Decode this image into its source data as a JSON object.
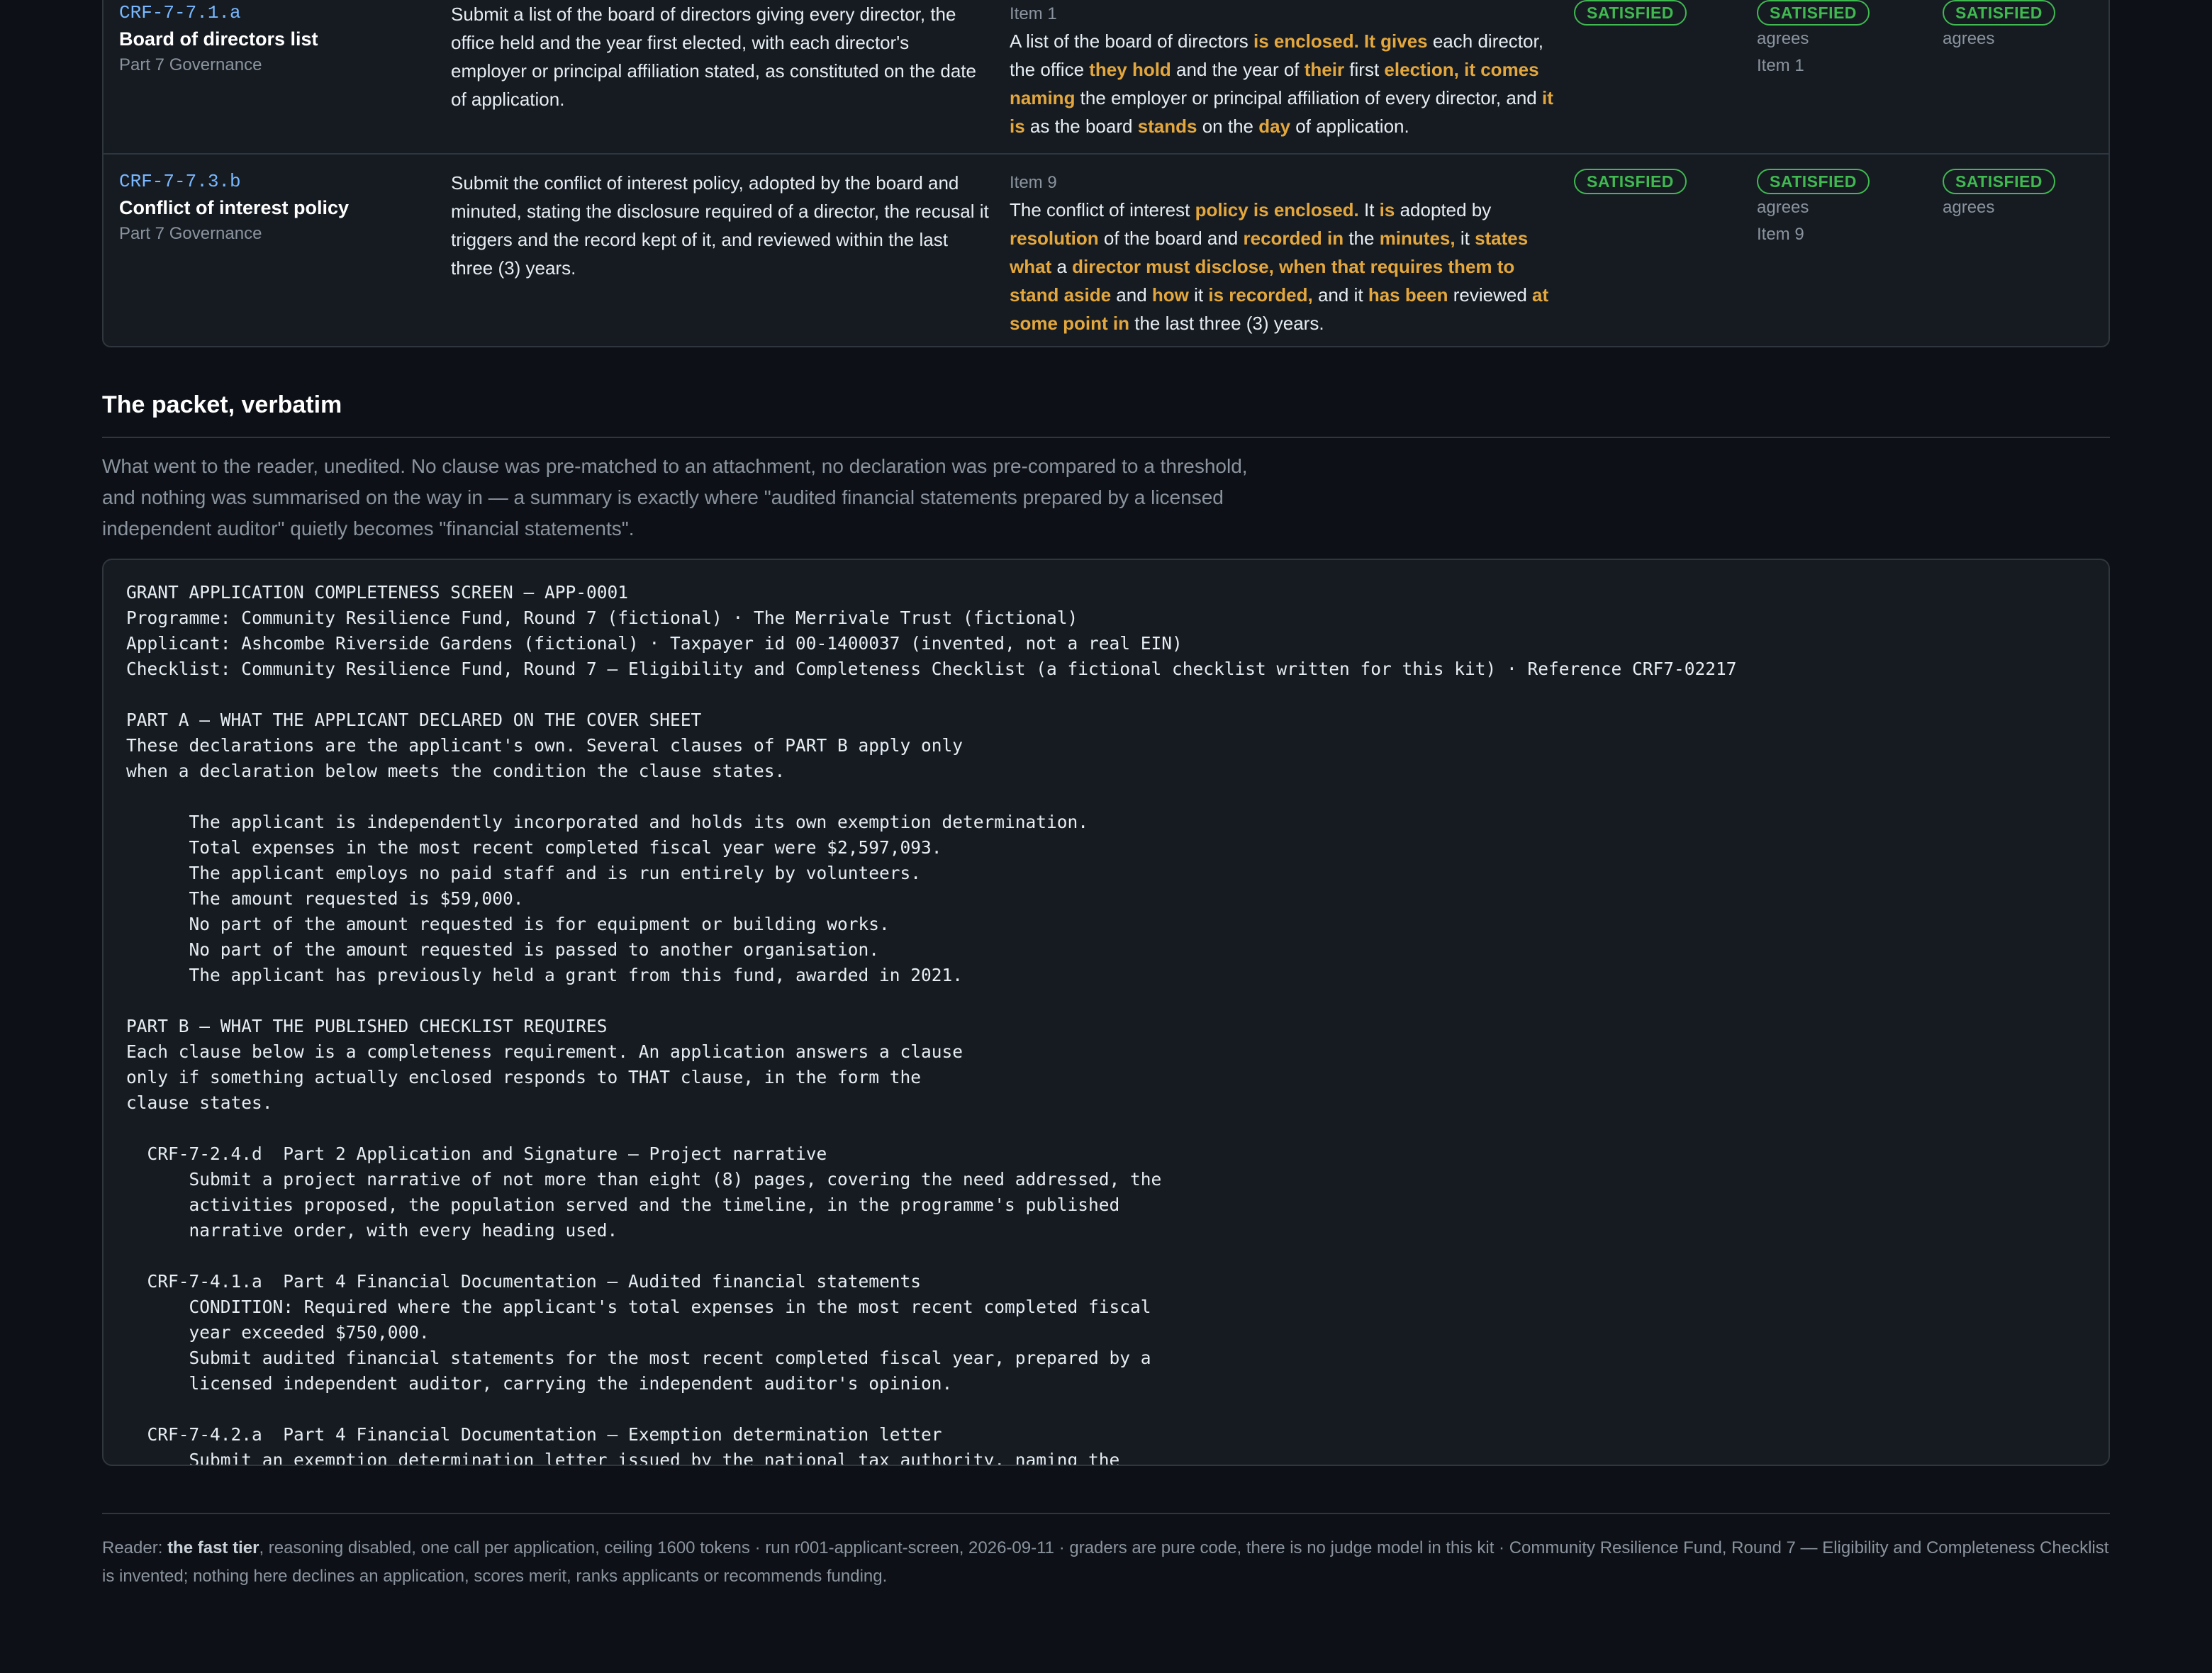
{
  "rows": [
    {
      "id": "CRF-7-7.1.a",
      "title": "Board of directors list",
      "part": "Part 7 Governance",
      "requirement": "Submit a list of the board of directors giving every director, the office held and the year first elected, with each director's employer or principal affiliation stated, as constituted on the date of application.",
      "evidence_item": "Item 1",
      "evidence_segments": [
        {
          "t": "A list of the board of directors ",
          "h": false
        },
        {
          "t": "is enclosed. It gives",
          "h": true
        },
        {
          "t": " each director, the office ",
          "h": false
        },
        {
          "t": "they hold",
          "h": true
        },
        {
          "t": " and the year of ",
          "h": false
        },
        {
          "t": "their",
          "h": true
        },
        {
          "t": " first ",
          "h": false
        },
        {
          "t": "election, it comes naming",
          "h": true
        },
        {
          "t": " the employer or principal affiliation of every director, and ",
          "h": false
        },
        {
          "t": "it is",
          "h": true
        },
        {
          "t": " as the board ",
          "h": false
        },
        {
          "t": "stands",
          "h": true
        },
        {
          "t": " on the ",
          "h": false
        },
        {
          "t": "day",
          "h": true
        },
        {
          "t": " of application.",
          "h": false
        }
      ],
      "status_1": "SATISFIED",
      "status_2": "SATISFIED",
      "status_2_note": "agrees",
      "status_2_item": "Item 1",
      "status_3": "SATISFIED",
      "status_3_note": "agrees"
    },
    {
      "id": "CRF-7-7.3.b",
      "title": "Conflict of interest policy",
      "part": "Part 7 Governance",
      "requirement": "Submit the conflict of interest policy, adopted by the board and minuted, stating the disclosure required of a director, the recusal it triggers and the record kept of it, and reviewed within the last three (3) years.",
      "evidence_item": "Item 9",
      "evidence_segments": [
        {
          "t": "The conflict of interest ",
          "h": false
        },
        {
          "t": "policy is enclosed.",
          "h": true
        },
        {
          "t": " It ",
          "h": false
        },
        {
          "t": "is",
          "h": true
        },
        {
          "t": " adopted by ",
          "h": false
        },
        {
          "t": "resolution",
          "h": true
        },
        {
          "t": " of the board and ",
          "h": false
        },
        {
          "t": "recorded in",
          "h": true
        },
        {
          "t": " the ",
          "h": false
        },
        {
          "t": "minutes,",
          "h": true
        },
        {
          "t": " it ",
          "h": false
        },
        {
          "t": "states what",
          "h": true
        },
        {
          "t": " a ",
          "h": false
        },
        {
          "t": "director must disclose, when that requires them to stand aside",
          "h": true
        },
        {
          "t": " and ",
          "h": false
        },
        {
          "t": "how",
          "h": true
        },
        {
          "t": " it ",
          "h": false
        },
        {
          "t": "is recorded,",
          "h": true
        },
        {
          "t": " and it ",
          "h": false
        },
        {
          "t": "has been",
          "h": true
        },
        {
          "t": " reviewed ",
          "h": false
        },
        {
          "t": "at some point in",
          "h": true
        },
        {
          "t": " the last three (3) years.",
          "h": false
        }
      ],
      "status_1": "SATISFIED",
      "status_2": "SATISFIED",
      "status_2_note": "agrees",
      "status_2_item": "Item 9",
      "status_3": "SATISFIED",
      "status_3_note": "agrees"
    }
  ],
  "section": {
    "title": "The packet, verbatim",
    "intro": "What went to the reader, unedited. No clause was pre-matched to an attachment, no declaration was pre-compared to a threshold, and nothing was summarised on the way in — a summary is exactly where \"audited financial statements prepared by a licensed independent auditor\" quietly becomes \"financial statements\"."
  },
  "packet_text": "GRANT APPLICATION COMPLETENESS SCREEN — APP-0001\nProgramme: Community Resilience Fund, Round 7 (fictional) · The Merrivale Trust (fictional)\nApplicant: Ashcombe Riverside Gardens (fictional) · Taxpayer id 00-1400037 (invented, not a real EIN)\nChecklist: Community Resilience Fund, Round 7 — Eligibility and Completeness Checklist (a fictional checklist written for this kit) · Reference CRF7-02217\n\nPART A — WHAT THE APPLICANT DECLARED ON THE COVER SHEET\nThese declarations are the applicant's own. Several clauses of PART B apply only\nwhen a declaration below meets the condition the clause states.\n\n      The applicant is independently incorporated and holds its own exemption determination.\n      Total expenses in the most recent completed fiscal year were $2,597,093.\n      The applicant employs no paid staff and is run entirely by volunteers.\n      The amount requested is $59,000.\n      No part of the amount requested is for equipment or building works.\n      No part of the amount requested is passed to another organisation.\n      The applicant has previously held a grant from this fund, awarded in 2021.\n\nPART B — WHAT THE PUBLISHED CHECKLIST REQUIRES\nEach clause below is a completeness requirement. An application answers a clause\nonly if something actually enclosed responds to THAT clause, in the form the\nclause states.\n\n  CRF-7-2.4.d  Part 2 Application and Signature — Project narrative\n      Submit a project narrative of not more than eight (8) pages, covering the need addressed, the\n      activities proposed, the population served and the timeline, in the programme's published\n      narrative order, with every heading used.\n\n  CRF-7-4.1.a  Part 4 Financial Documentation — Audited financial statements\n      CONDITION: Required where the applicant's total expenses in the most recent completed fiscal\n      year exceeded $750,000.\n      Submit audited financial statements for the most recent completed fiscal year, prepared by a\n      licensed independent auditor, carrying the independent auditor's opinion.\n\n  CRF-7-4.2.a  Part 4 Financial Documentation — Exemption determination letter\n      Submit an exemption determination letter issued by the national tax authority, naming the",
  "footer": {
    "prefix": "Reader: ",
    "bold": "the fast tier",
    "rest": ", reasoning disabled, one call per application, ceiling 1600 tokens · run r001-applicant-screen, 2026-09-11 · graders are pure code, there is no judge model in this kit · Community Resilience Fund, Round 7 — Eligibility and Completeness Checklist is invented; nothing here declines an application, scores merit, ranks applicants or recommends funding."
  },
  "colors": {
    "background": "#0d1117",
    "panel": "#161b22",
    "highlight": "#e3a73d",
    "satisfied": "#3fb950",
    "id_link": "#79b8ff"
  }
}
